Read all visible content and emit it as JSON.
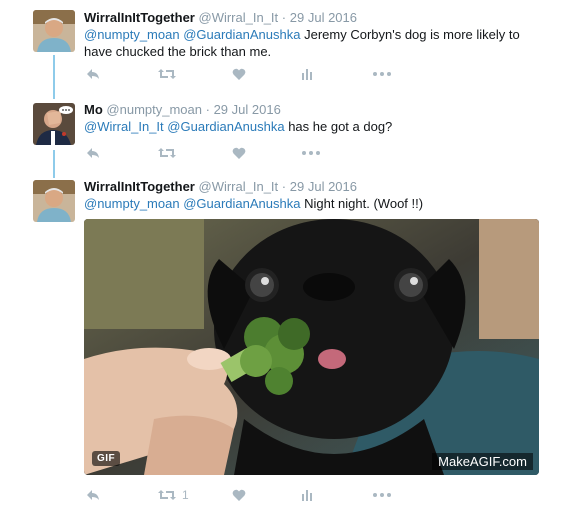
{
  "tweets": [
    {
      "name": "WirralInItTogether",
      "handle": "@Wirral_In_It",
      "separator": "·",
      "date": "29 Jul 2016",
      "mentions": [
        "@numpty_moan",
        "@GuardianAnushka"
      ],
      "text_line1": " Jeremy Corbyn's dog is more likely to",
      "text_line2": "have chucked the brick than me.",
      "retweet_count": "",
      "avatar": "man-with-white-hair-avatar"
    },
    {
      "name": "Mo",
      "handle": "@numpty_moan",
      "separator": "·",
      "date": "29 Jul 2016",
      "mentions": [
        "@Wirral_In_It",
        "@GuardianAnushka"
      ],
      "text": " has he got a dog?",
      "avatar": "man-facepalm-avatar"
    },
    {
      "name": "WirralInItTogether",
      "handle": "@Wirral_In_It",
      "separator": "·",
      "date": "29 Jul 2016",
      "mentions": [
        "@numpty_moan",
        "@GuardianAnushka"
      ],
      "text": " Night night. (Woof !!)",
      "retweet_count": "1",
      "media": {
        "type": "gif",
        "badge": "GIF",
        "watermark": "MakeAGIF.com",
        "description_icon": "pug-eating-broccoli"
      },
      "avatar": "man-with-white-hair-avatar"
    }
  ],
  "colors": {
    "link": "#2b7bb9",
    "meta": "#8899a6",
    "action_icon": "#aab8c2",
    "thread_line": "#8ecbea"
  }
}
